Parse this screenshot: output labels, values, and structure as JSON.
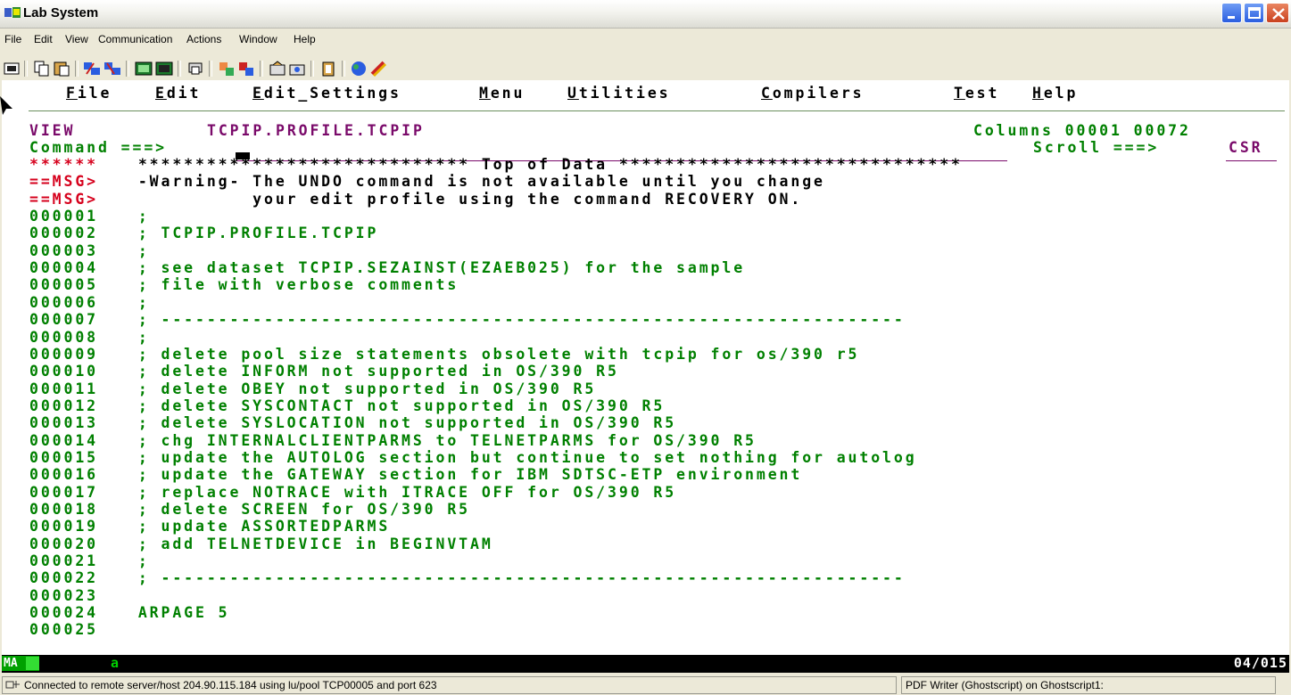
{
  "window": {
    "title": "Lab System"
  },
  "menubar": [
    "File",
    "Edit",
    "View",
    "Communication",
    "Actions",
    "Window",
    "Help"
  ],
  "ispf_menu": [
    {
      "first": "F",
      "rest": "ile"
    },
    {
      "first": "E",
      "rest": "dit"
    },
    {
      "first": "E",
      "rest": "dit_Settings"
    },
    {
      "first": "M",
      "rest": "enu"
    },
    {
      "first": "U",
      "rest": "tilities"
    },
    {
      "first": "C",
      "rest": "ompilers"
    },
    {
      "first": "T",
      "rest": "est"
    },
    {
      "first": "H",
      "rest": "elp"
    }
  ],
  "edit_header": {
    "mode": "VIEW",
    "dataset": "TCPIP.PROFILE.TCPIP",
    "columns": "Columns 00001 00072",
    "command_label": "Command ===>",
    "scroll_label": "Scroll ===>",
    "scroll_value": "CSR"
  },
  "lines": [
    {
      "num": "******",
      "text": " ***************************** Top of Data ******************************",
      "kind": "top"
    },
    {
      "num": "==MSG>",
      "text": " -Warning- The UNDO command is not available until you change",
      "kind": "msg"
    },
    {
      "num": "==MSG>",
      "text": "           your edit profile using the command RECOVERY ON.",
      "kind": "msg"
    },
    {
      "num": "000001",
      "text": " ;",
      "kind": "data"
    },
    {
      "num": "000002",
      "text": " ; TCPIP.PROFILE.TCPIP",
      "kind": "data"
    },
    {
      "num": "000003",
      "text": " ;",
      "kind": "data"
    },
    {
      "num": "000004",
      "text": " ; see dataset TCPIP.SEZAINST(EZAEB025) for the sample",
      "kind": "data"
    },
    {
      "num": "000005",
      "text": " ; file with verbose comments",
      "kind": "data"
    },
    {
      "num": "000006",
      "text": " ;",
      "kind": "data"
    },
    {
      "num": "000007",
      "text": " ; -----------------------------------------------------------------",
      "kind": "data"
    },
    {
      "num": "000008",
      "text": " ;",
      "kind": "data"
    },
    {
      "num": "000009",
      "text": " ; delete pool size statements obsolete with tcpip for os/390 r5",
      "kind": "data"
    },
    {
      "num": "000010",
      "text": " ; delete INFORM not supported in OS/390 R5",
      "kind": "data"
    },
    {
      "num": "000011",
      "text": " ; delete OBEY not supported in OS/390 R5",
      "kind": "data"
    },
    {
      "num": "000012",
      "text": " ; delete SYSCONTACT not supported in OS/390 R5",
      "kind": "data"
    },
    {
      "num": "000013",
      "text": " ; delete SYSLOCATION not supported in OS/390 R5",
      "kind": "data"
    },
    {
      "num": "000014",
      "text": " ; chg INTERNALCLIENTPARMS to TELNETPARMS for OS/390 R5",
      "kind": "data"
    },
    {
      "num": "000015",
      "text": " ; update the AUTOLOG section but continue to set nothing for autolog",
      "kind": "data"
    },
    {
      "num": "000016",
      "text": " ; update the GATEWAY section for IBM SDTSC-ETP environment",
      "kind": "data"
    },
    {
      "num": "000017",
      "text": " ; replace NOTRACE with ITRACE OFF for OS/390 R5",
      "kind": "data"
    },
    {
      "num": "000018",
      "text": " ; delete SCREEN for OS/390 R5",
      "kind": "data"
    },
    {
      "num": "000019",
      "text": " ; update ASSORTEDPARMS",
      "kind": "data"
    },
    {
      "num": "000020",
      "text": " ; add TELNETDEVICE in BEGINVTAM",
      "kind": "data"
    },
    {
      "num": "000021",
      "text": " ;",
      "kind": "data"
    },
    {
      "num": "000022",
      "text": " ; -----------------------------------------------------------------",
      "kind": "data"
    },
    {
      "num": "000023",
      "text": "",
      "kind": "data"
    },
    {
      "num": "000024",
      "text": " ARPAGE 5",
      "kind": "data"
    },
    {
      "num": "000025",
      "text": "",
      "kind": "data"
    }
  ],
  "oia": {
    "indicator": "MA",
    "session": "a",
    "cursor_pos": "04/015"
  },
  "statusbar": {
    "connection": "Connected to remote server/host 204.90.115.184 using lu/pool TCP00005 and port 623",
    "printer": "PDF Writer (Ghostscript) on Ghostscript1:"
  },
  "colors": {
    "green": "#008000",
    "purple": "#7a0a6a",
    "red": "#d6001c",
    "oia_green": "#00a000"
  },
  "icons": [
    "terminal-app-icon",
    "minimize-icon",
    "maximize-icon",
    "close-icon",
    "connection-icon"
  ]
}
